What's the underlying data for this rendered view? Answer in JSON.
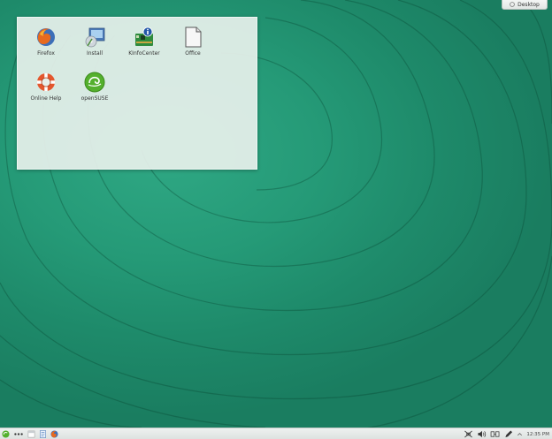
{
  "desktop": {
    "toolbox_label": "Desktop",
    "icons": [
      {
        "label": "Firefox",
        "icon": "firefox-icon"
      },
      {
        "label": "Install",
        "icon": "install-icon"
      },
      {
        "label": "KInfoCenter",
        "icon": "kinfocenter-icon"
      },
      {
        "label": "Office",
        "icon": "office-document-icon"
      },
      {
        "label": "Online Help",
        "icon": "lifebuoy-icon"
      },
      {
        "label": "openSUSE",
        "icon": "opensuse-logo-icon"
      }
    ]
  },
  "taskbar": {
    "clock": "12:35 PM",
    "launchers": [
      "application-menu-icon",
      "more-dots-icon",
      "file-manager-icon",
      "text-editor-icon",
      "firefox-icon"
    ],
    "tray": [
      "network-icon",
      "volume-icon",
      "battery-icon",
      "pen-icon",
      "chevron-up-icon"
    ]
  },
  "colors": {
    "wallpaper": "#259a77",
    "panel": "#e6f0eb",
    "taskbar": "#eef1f0"
  }
}
